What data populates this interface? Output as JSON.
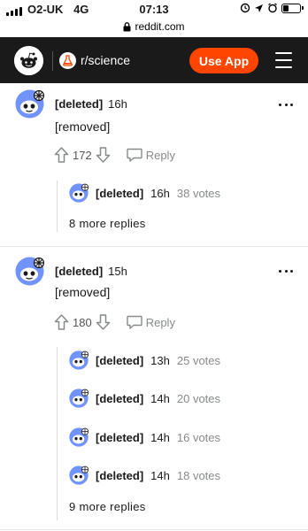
{
  "status_bar": {
    "carrier": "O2-UK",
    "network": "4G",
    "time": "07:13"
  },
  "browser": {
    "url": "reddit.com"
  },
  "header": {
    "subreddit": "r/science",
    "use_app_label": "Use App"
  },
  "comments": [
    {
      "author": "[deleted]",
      "age": "16h",
      "body": "[removed]",
      "score": "172",
      "reply_label": "Reply",
      "children": [
        {
          "author": "[deleted]",
          "age": "16h",
          "votes": "38 votes"
        }
      ],
      "more_replies": "8 more replies"
    },
    {
      "author": "[deleted]",
      "age": "15h",
      "body": "[removed]",
      "score": "180",
      "reply_label": "Reply",
      "children": [
        {
          "author": "[deleted]",
          "age": "13h",
          "votes": "25 votes"
        },
        {
          "author": "[deleted]",
          "age": "14h",
          "votes": "20 votes"
        },
        {
          "author": "[deleted]",
          "age": "14h",
          "votes": "16 votes"
        },
        {
          "author": "[deleted]",
          "age": "14h",
          "votes": "18 votes"
        }
      ],
      "more_replies": "9 more replies"
    }
  ],
  "colors": {
    "brand": "#ff4500",
    "header_bg": "#1a1a1b",
    "avatar": "#7193ff",
    "muted": "#878a8c"
  },
  "icons": [
    "signal-icon",
    "lock-icon",
    "alarm-icon",
    "location-icon",
    "battery-icon",
    "reddit-logo-icon",
    "subreddit-icon",
    "menu-icon",
    "upvote-icon",
    "downvote-icon",
    "reply-icon",
    "more-options-icon",
    "avatar-icon"
  ]
}
